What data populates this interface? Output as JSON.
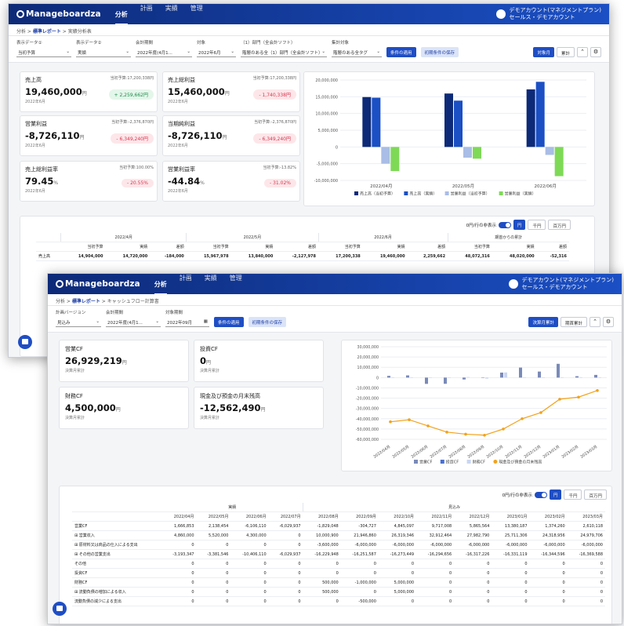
{
  "colors": {
    "navy": "#0d2a78",
    "blue": "#1b4fc4",
    "light_blue": "#a9bde6",
    "green": "#7ed957",
    "orange": "#f2a21b",
    "neg": "#d33a51",
    "pos": "#1e8c4b"
  },
  "app": {
    "logo": "Manageboardza",
    "nav": [
      "分析",
      "計画",
      "実績",
      "管理"
    ],
    "user_line1": "デモアカウント(マネジメントプラン)",
    "user_line2": "セールス・デモアカウント"
  },
  "w1": {
    "breadcrumb": [
      "分析",
      "標準レポート",
      "実績分析表"
    ],
    "filters": [
      {
        "label": "表示データ①",
        "value": "当初予算"
      },
      {
        "label": "表示データ②",
        "value": "実績"
      },
      {
        "label": "会計期間",
        "value": "2022年度(4月1..."
      },
      {
        "label": "対象",
        "value": "2022年6月"
      },
      {
        "label": "（1）部門（全会計ソフト）",
        "value": "階層のある全（1）部門（全会計ソフト）"
      },
      {
        "label": "集計対象",
        "value": "階層のある全タグ"
      }
    ],
    "apply": "条件の適用",
    "save": "初期条件の保存",
    "tab_month": "対象月",
    "tab_total": "累計",
    "kpis": [
      {
        "label": "売上高",
        "budget": "当初予算:17,200,338円",
        "value": "19,460,000",
        "unit": "円",
        "period": "2022年6月",
        "diff": "+ 2,259,662円",
        "sign": "pos"
      },
      {
        "label": "売上総利益",
        "budget": "当初予算:17,200,338円",
        "value": "15,460,000",
        "unit": "円",
        "period": "2022年6月",
        "diff": "- 1,740,338円",
        "sign": "neg"
      },
      {
        "label": "営業利益",
        "budget": "当初予算:-2,376,870円",
        "value": "-8,726,110",
        "unit": "円",
        "period": "2022年6月",
        "diff": "- 6,349,240円",
        "sign": "neg"
      },
      {
        "label": "当期純利益",
        "budget": "当初予算:-2,376,870円",
        "value": "-8,726,110",
        "unit": "円",
        "period": "2022年6月",
        "diff": "- 6,349,240円",
        "sign": "neg"
      },
      {
        "label": "売上総利益率",
        "budget": "当初予算:100.00%",
        "value": "79.45",
        "unit": "%",
        "period": "2022年6月",
        "diff": "- 20.55%",
        "sign": "neg"
      },
      {
        "label": "営業利益率",
        "budget": "当初予算:-13.82%",
        "value": "-44.84",
        "unit": "%",
        "period": "2022年6月",
        "diff": "- 31.02%",
        "sign": "neg"
      }
    ],
    "table_toggle": "0円/行の非表示",
    "units": [
      "円",
      "千円",
      "百万円"
    ],
    "table_months": [
      "2022/4月",
      "2022/5月",
      "2022/6月",
      "期首からの累計"
    ],
    "table_cols": [
      "当初予算",
      "実績",
      "差額"
    ],
    "table_row_label": "売上高",
    "table_row": [
      "14,904,000",
      "14,720,000",
      "-184,000",
      "15,967,978",
      "13,840,000",
      "-2,127,978",
      "17,200,338",
      "19,460,000",
      "2,259,662",
      "48,072,316",
      "48,020,000",
      "-52,316"
    ]
  },
  "w2": {
    "breadcrumb": [
      "分析",
      "標準レポート",
      "キャッシュフロー計算書"
    ],
    "filters": [
      {
        "label": "計画バージョン",
        "value": "見込み"
      },
      {
        "label": "会計期間",
        "value": "2022年度(4月1..."
      },
      {
        "label": "対象期間",
        "value": "2022年09月"
      }
    ],
    "apply": "条件の適用",
    "save": "初期条件の保存",
    "tab_month": "決算月累計",
    "tab_total": "期首累計",
    "kpis": [
      {
        "label": "営業CF",
        "value": "26,929,219",
        "unit": "円",
        "period": "決算月累計"
      },
      {
        "label": "投資CF",
        "value": "0",
        "unit": "円",
        "period": "決算月累計"
      },
      {
        "label": "財務CF",
        "value": "4,500,000",
        "unit": "円",
        "period": "決算月累計"
      },
      {
        "label": "現金及び預金の月末残高",
        "value": "-12,562,490",
        "unit": "円",
        "period": "決算月累計"
      }
    ],
    "table_toggle": "0円/行の非表示",
    "units": [
      "円",
      "千円",
      "百万円"
    ],
    "group_actual": "実績",
    "group_forecast": "見込み",
    "months": [
      "2022/04月",
      "2022/05月",
      "2022/06月",
      "2022/07月",
      "2022/08月",
      "2022/09月",
      "2022/10月",
      "2022/11月",
      "2022/12月",
      "2023/01月",
      "2023/02月",
      "2023/03月"
    ],
    "rows": [
      {
        "label": "営業CF",
        "vals": [
          "1,666,853",
          "2,138,454",
          "-6,106,110",
          "-6,029,937",
          "-1,829,048",
          "-304,727",
          "4,845,097",
          "9,717,008",
          "5,865,564",
          "13,380,187",
          "1,374,260",
          "2,610,118"
        ]
      },
      {
        "label": "⊞ 営業収入",
        "vals": [
          "4,860,000",
          "5,520,000",
          "4,300,000",
          "0",
          "10,000,900",
          "21,946,860",
          "26,319,346",
          "32,912,464",
          "27,982,790",
          "25,711,306",
          "24,318,956",
          "24,979,706"
        ]
      },
      {
        "label": "⊞ 原材料又は商品の仕入による支出",
        "vals": [
          "0",
          "0",
          "0",
          "0",
          "-3,600,000",
          "-6,000,000",
          "-6,000,000",
          "-6,000,000",
          "-6,000,000",
          "-6,000,000",
          "-6,000,000",
          "-6,000,000"
        ]
      },
      {
        "label": "⊞ その他の営業支出",
        "vals": [
          "-3,193,347",
          "-3,381,546",
          "-10,406,110",
          "-6,029,937",
          "-16,229,948",
          "-16,251,587",
          "-16,273,449",
          "-16,294,656",
          "-16,317,226",
          "-16,331,119",
          "-16,344,596",
          "-16,369,588"
        ]
      },
      {
        "label": "その他",
        "vals": [
          "0",
          "0",
          "0",
          "0",
          "0",
          "0",
          "0",
          "0",
          "0",
          "0",
          "0",
          "0"
        ]
      },
      {
        "label": "投資CF",
        "vals": [
          "0",
          "0",
          "0",
          "0",
          "0",
          "0",
          "0",
          "0",
          "0",
          "0",
          "0",
          "0"
        ]
      },
      {
        "label": "財務CF",
        "vals": [
          "0",
          "0",
          "0",
          "0",
          "500,000",
          "-1,000,000",
          "5,000,000",
          "0",
          "0",
          "0",
          "0",
          "0"
        ]
      },
      {
        "label": "⊞ 流動負債の増加による収入",
        "vals": [
          "0",
          "0",
          "0",
          "0",
          "500,000",
          "0",
          "5,000,000",
          "0",
          "0",
          "0",
          "0",
          "0"
        ]
      },
      {
        "label": "流動負債の減少による支出",
        "vals": [
          "0",
          "0",
          "0",
          "0",
          "0",
          "-500,000",
          "0",
          "0",
          "0",
          "0",
          "0",
          "0"
        ]
      }
    ]
  },
  "chart_data": [
    {
      "type": "bar",
      "categories": [
        "2022/04月",
        "2022/05月",
        "2022/06月"
      ],
      "series": [
        {
          "name": "売上高（当初予算）",
          "values": [
            14904000,
            15967978,
            17200338
          ]
        },
        {
          "name": "売上高（実績）",
          "values": [
            14720000,
            13840000,
            19460000
          ]
        },
        {
          "name": "営業利益（当初予算）",
          "values": [
            -5000000,
            -3200000,
            -2376870
          ]
        },
        {
          "name": "営業利益（実績）",
          "values": [
            -7200000,
            -3500000,
            -8726110
          ]
        }
      ],
      "ylim": [
        -10000000,
        20000000
      ],
      "yticks": [
        "20,000,000",
        "15,000,000",
        "10,000,000",
        "5,000,000",
        "0",
        "-5,000,000",
        "-10,000,000"
      ]
    },
    {
      "type": "bar",
      "categories": [
        "2022/04月",
        "2022/05月",
        "2022/06月",
        "2022/07月",
        "2022/08月",
        "2022/09月",
        "2022/10月",
        "2022/11月",
        "2022/12月",
        "2023/01月",
        "2023/02月",
        "2023/03月"
      ],
      "series": [
        {
          "name": "営業CF",
          "values": [
            1666853,
            2138454,
            -6106110,
            -6029937,
            -1829048,
            -304727,
            4845097,
            9717008,
            5865564,
            13380187,
            1374260,
            2610118
          ]
        },
        {
          "name": "投資CF",
          "values": [
            0,
            0,
            0,
            0,
            0,
            0,
            0,
            0,
            0,
            0,
            0,
            0
          ]
        },
        {
          "name": "財務CF",
          "values": [
            0,
            0,
            0,
            0,
            500000,
            -1000000,
            5000000,
            0,
            0,
            0,
            0,
            0
          ]
        },
        {
          "name": "現金及び預金の月末残高",
          "values": [
            -43000000,
            -41000000,
            -47000000,
            -53000000,
            -55000000,
            -56000000,
            -50000000,
            -40000000,
            -34000000,
            -21000000,
            -19000000,
            -12562490
          ]
        }
      ],
      "ylim": [
        -60000000,
        30000000
      ],
      "yticks": [
        "30,000,000",
        "20,000,000",
        "10,000,000",
        "0",
        "-10,000,000",
        "-20,000,000",
        "-30,000,000",
        "-40,000,000",
        "-50,000,000",
        "-60,000,000"
      ]
    }
  ]
}
